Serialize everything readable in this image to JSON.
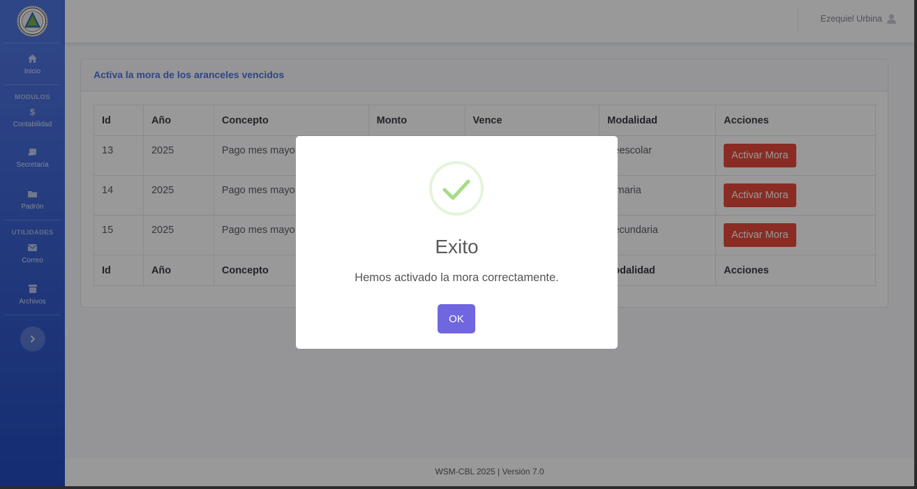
{
  "sidebar": {
    "items_main": [
      {
        "label": "Inicio",
        "icon": "home-icon"
      }
    ],
    "heading_modulos": "MODULOS",
    "items_modulos": [
      {
        "label": "Contabilidad",
        "icon": "dollar-icon"
      },
      {
        "label": "Secretaría",
        "icon": "scroll-icon"
      },
      {
        "label": "Padrón",
        "icon": "folder-icon"
      }
    ],
    "heading_utilidades": "UTILIDADES",
    "items_utilidades": [
      {
        "label": "Correo",
        "icon": "envelope-icon"
      },
      {
        "label": "Archivos",
        "icon": "archive-icon"
      }
    ]
  },
  "topbar": {
    "user_name": "Ezequiel Urbina"
  },
  "card": {
    "title": "Activa la mora de los aranceles vencidos",
    "columns": [
      "Id",
      "Año",
      "Concepto",
      "Monto",
      "Vence",
      "Modalidad",
      "Acciones"
    ],
    "rows": [
      {
        "id": "13",
        "year": "2025",
        "concept": "Pago mes mayo",
        "modality": "eescolar",
        "action": "Activar Mora"
      },
      {
        "id": "14",
        "year": "2025",
        "concept": "Pago mes mayo",
        "modality": "imaria",
        "action": "Activar Mora"
      },
      {
        "id": "15",
        "year": "2025",
        "concept": "Pago mes mayo",
        "modality": "ecundaria",
        "action": "Activar Mora"
      }
    ],
    "footer_visible": {
      "id": "Id",
      "year": "Año",
      "concept": "Concepto",
      "modality": "odalidad",
      "actions": "Acciones"
    }
  },
  "footer": {
    "text": "WSM-CBL 2025 | Versión 7.0"
  },
  "modal": {
    "title": "Exito",
    "text": "Hemos activado la mora correctamente.",
    "ok_label": "OK"
  },
  "colors": {
    "primary": "#4e73df",
    "danger": "#e74a3b",
    "confirm": "#7066e0",
    "success": "#a5dc86"
  }
}
